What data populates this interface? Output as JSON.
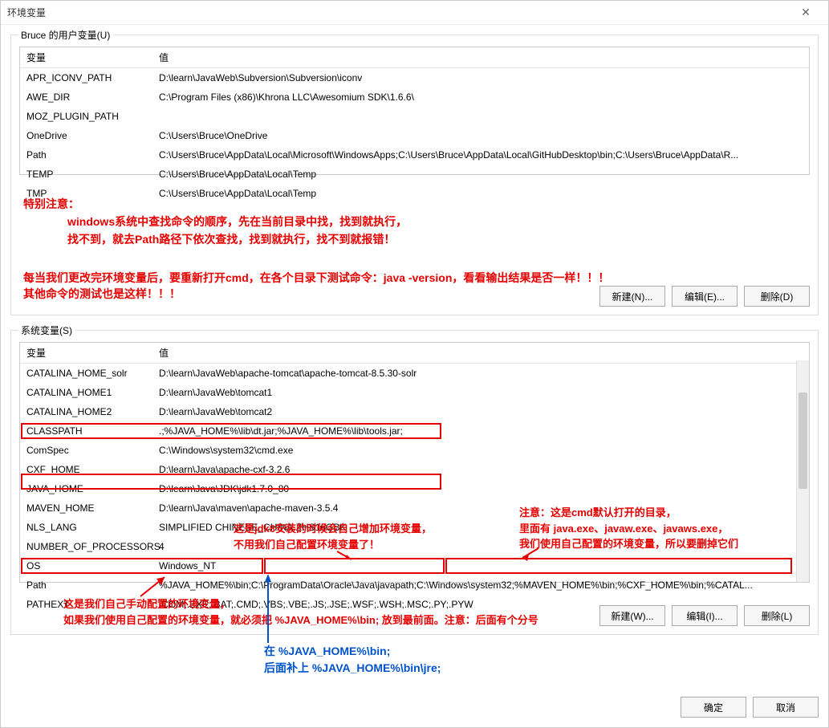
{
  "window": {
    "title": "环境变量"
  },
  "user_vars": {
    "legend": "Bruce 的用户变量(U)",
    "headers": {
      "name": "变量",
      "value": "值"
    },
    "rows": [
      {
        "name": "APR_ICONV_PATH",
        "value": "D:\\learn\\JavaWeb\\Subversion\\Subversion\\iconv"
      },
      {
        "name": "AWE_DIR",
        "value": "C:\\Program Files (x86)\\Khrona LLC\\Awesomium SDK\\1.6.6\\"
      },
      {
        "name": "MOZ_PLUGIN_PATH",
        "value": ""
      },
      {
        "name": "OneDrive",
        "value": "C:\\Users\\Bruce\\OneDrive"
      },
      {
        "name": "Path",
        "value": "C:\\Users\\Bruce\\AppData\\Local\\Microsoft\\WindowsApps;C:\\Users\\Bruce\\AppData\\Local\\GitHubDesktop\\bin;C:\\Users\\Bruce\\AppData\\R..."
      },
      {
        "name": "TEMP",
        "value": "C:\\Users\\Bruce\\AppData\\Local\\Temp"
      },
      {
        "name": "TMP",
        "value": "C:\\Users\\Bruce\\AppData\\Local\\Temp"
      }
    ],
    "buttons": {
      "new": "新建(N)...",
      "edit": "编辑(E)...",
      "delete": "删除(D)"
    }
  },
  "sys_vars": {
    "legend": "系统变量(S)",
    "headers": {
      "name": "变量",
      "value": "值"
    },
    "rows": [
      {
        "name": "CATALINA_HOME_solr",
        "value": "D:\\learn\\JavaWeb\\apache-tomcat\\apache-tomcat-8.5.30-solr"
      },
      {
        "name": "CATALINA_HOME1",
        "value": "D:\\learn\\JavaWeb\\tomcat1"
      },
      {
        "name": "CATALINA_HOME2",
        "value": "D:\\learn\\JavaWeb\\tomcat2"
      },
      {
        "name": "CLASSPATH",
        "value": ".;%JAVA_HOME%\\lib\\dt.jar;%JAVA_HOME%\\lib\\tools.jar;"
      },
      {
        "name": "ComSpec",
        "value": "C:\\Windows\\system32\\cmd.exe"
      },
      {
        "name": "CXF_HOME",
        "value": "D:\\learn\\Java\\apache-cxf-3.2.6"
      },
      {
        "name": "JAVA_HOME",
        "value": "D:\\learn\\Java\\JDK\\jdk1.7.0_80"
      },
      {
        "name": "MAVEN_HOME",
        "value": "D:\\learn\\Java\\maven\\apache-maven-3.5.4"
      },
      {
        "name": "NLS_LANG",
        "value": "SIMPLIFIED CHINESE_CHINA.ZHS16GBK"
      },
      {
        "name": "NUMBER_OF_PROCESSORS",
        "value": "4"
      },
      {
        "name": "OS",
        "value": "Windows_NT"
      },
      {
        "name": "Path",
        "value": "%JAVA_HOME%\\bin;C:\\ProgramData\\Oracle\\Java\\javapath;C:\\Windows\\system32;%MAVEN_HOME%\\bin;%CXF_HOME%\\bin;%CATAL..."
      },
      {
        "name": "PATHEXT",
        "value": ".COM;.EXE;.BAT;.CMD;.VBS;.VBE;.JS;.JSE;.WSF;.WSH;.MSC;.PY;.PYW"
      }
    ],
    "buttons": {
      "new": "新建(W)...",
      "edit": "编辑(I)...",
      "delete": "删除(L)"
    }
  },
  "footer": {
    "ok": "确定",
    "cancel": "取消"
  },
  "annotations": {
    "a1_title": "特别注意：",
    "a1_l1": "windows系统中查找命令的顺序，先在当前目录中找，找到就执行，",
    "a1_l2": "找不到，就去Path路径下依次查找，找到就执行，找不到就报错！",
    "a2": "每当我们更改完环境变量后，要重新打开cmd，在各个目录下测试命令：java -version，看看输出结果是否一样！！！",
    "a3": "其他命令的测试也是这样！！！",
    "b1_l1": "这是jdk8安装的时候会自己增加环境变量，",
    "b1_l2": "不用我们自己配置环境变量了！",
    "c1_l1": "注意：这是cmd默认打开的目录，",
    "c1_l2": "里面有 java.exe、javaw.exe、javaws.exe，",
    "c1_l3": "我们使用自己配置的环境变量，所以要删掉它们",
    "d1_l1": "这是我们自己手动配置的环境变量，",
    "d1_l2": "如果我们使用自己配置的环境变量，就必须把 %JAVA_HOME%\\bin; 放到最前面。注意：后面有个分号",
    "e1_l1": "在  %JAVA_HOME%\\bin;",
    "e1_l2": "后面补上  %JAVA_HOME%\\bin\\jre;"
  }
}
